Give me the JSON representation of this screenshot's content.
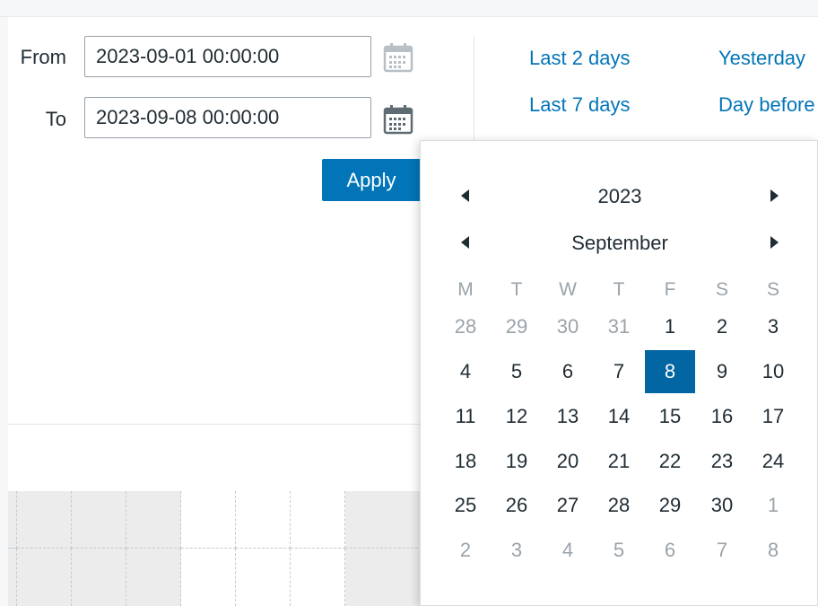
{
  "filter": {
    "from_label": "From",
    "from_value": "2023-09-01 00:00:00",
    "to_label": "To",
    "to_value": "2023-09-08 00:00:00",
    "apply_label": "Apply"
  },
  "quick_ranges": {
    "col1": [
      "Last 2 days",
      "Last 7 days"
    ],
    "col2": [
      "Yesterday",
      "Day before"
    ]
  },
  "calendar": {
    "year": "2023",
    "month": "September",
    "weekdays": [
      "M",
      "T",
      "W",
      "T",
      "F",
      "S",
      "S"
    ],
    "weeks": [
      [
        {
          "d": "28",
          "m": true
        },
        {
          "d": "29",
          "m": true
        },
        {
          "d": "30",
          "m": true
        },
        {
          "d": "31",
          "m": true
        },
        {
          "d": "1"
        },
        {
          "d": "2"
        },
        {
          "d": "3"
        }
      ],
      [
        {
          "d": "4"
        },
        {
          "d": "5"
        },
        {
          "d": "6"
        },
        {
          "d": "7"
        },
        {
          "d": "8",
          "sel": true
        },
        {
          "d": "9"
        },
        {
          "d": "10"
        }
      ],
      [
        {
          "d": "11"
        },
        {
          "d": "12"
        },
        {
          "d": "13"
        },
        {
          "d": "14"
        },
        {
          "d": "15"
        },
        {
          "d": "16"
        },
        {
          "d": "17"
        }
      ],
      [
        {
          "d": "18"
        },
        {
          "d": "19"
        },
        {
          "d": "20"
        },
        {
          "d": "21"
        },
        {
          "d": "22"
        },
        {
          "d": "23"
        },
        {
          "d": "24"
        }
      ],
      [
        {
          "d": "25"
        },
        {
          "d": "26"
        },
        {
          "d": "27"
        },
        {
          "d": "28"
        },
        {
          "d": "29"
        },
        {
          "d": "30"
        },
        {
          "d": "1",
          "m": true
        }
      ],
      [
        {
          "d": "2",
          "m": true
        },
        {
          "d": "3",
          "m": true
        },
        {
          "d": "4",
          "m": true
        },
        {
          "d": "5",
          "m": true
        },
        {
          "d": "6",
          "m": true
        },
        {
          "d": "7",
          "m": true
        },
        {
          "d": "8",
          "m": true
        }
      ]
    ]
  },
  "icons": {
    "calendar": "calendar-icon",
    "prev": "triangle-left-icon",
    "next": "triangle-right-icon"
  },
  "colors": {
    "accent": "#0275b8",
    "selected_day": "#0266a2",
    "muted_text": "#9aa3aa"
  }
}
